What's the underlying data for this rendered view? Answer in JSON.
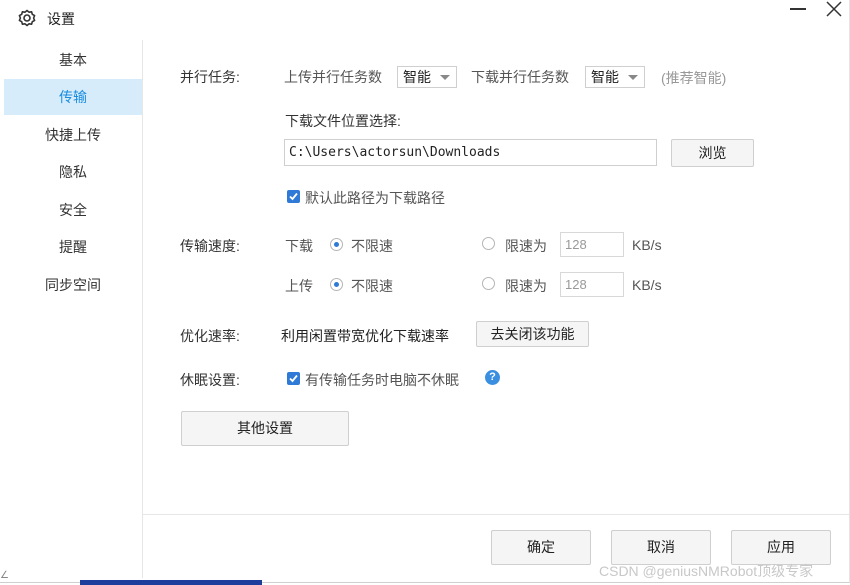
{
  "window": {
    "title": "设置",
    "icon": "gear-icon",
    "controls": {
      "minimize": "minimize-icon",
      "close": "close-icon"
    }
  },
  "sidebar": {
    "items": [
      {
        "label": "基本",
        "active": false
      },
      {
        "label": "传输",
        "active": true
      },
      {
        "label": "快捷上传",
        "active": false
      },
      {
        "label": "隐私",
        "active": false
      },
      {
        "label": "安全",
        "active": false
      },
      {
        "label": "提醒",
        "active": false
      },
      {
        "label": "同步空间",
        "active": false
      }
    ]
  },
  "parallel": {
    "label": "并行任务:",
    "upload_label": "上传并行任务数",
    "upload_value": "智能",
    "download_label": "下载并行任务数",
    "download_value": "智能",
    "recommend": "(推荐智能)"
  },
  "download_location": {
    "label": "下载文件位置选择:",
    "path": "C:\\Users\\actorsun\\Downloads",
    "browse_button": "浏览",
    "default_checkbox_label": "默认此路径为下载路径",
    "default_checked": true
  },
  "speed": {
    "label": "传输速度:",
    "download": {
      "label": "下载",
      "unlimited_label": "不限速",
      "unlimited_selected": true,
      "limit_label": "限速为",
      "limit_value": "128",
      "unit": "KB/s"
    },
    "upload": {
      "label": "上传",
      "unlimited_label": "不限速",
      "unlimited_selected": true,
      "limit_label": "限速为",
      "limit_value": "128",
      "unit": "KB/s"
    }
  },
  "optimize": {
    "label": "优化速率:",
    "description": "利用闲置带宽优化下载速率",
    "button": "去关闭该功能"
  },
  "sleep": {
    "label": "休眠设置:",
    "checkbox_label": "有传输任务时电脑不休眠",
    "checked": true,
    "help_glyph": "?"
  },
  "other_settings_button": "其他设置",
  "footer": {
    "ok": "确定",
    "cancel": "取消",
    "apply": "应用"
  },
  "watermark": "CSDN @geniusNMRobot顶级专家",
  "edge_fragment": "∠"
}
